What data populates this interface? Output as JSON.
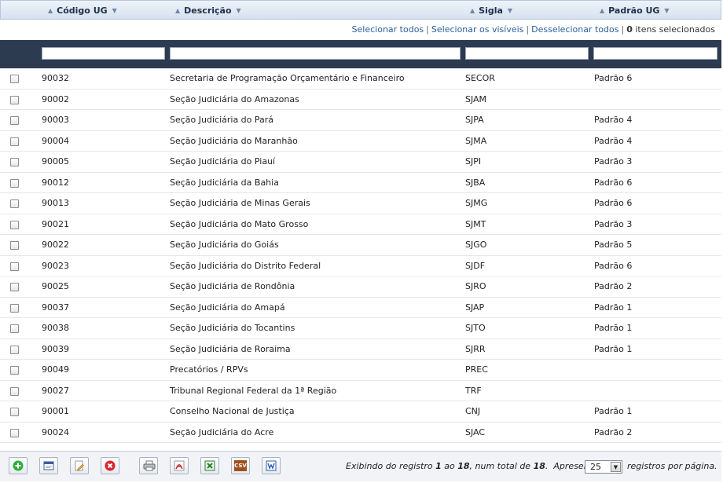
{
  "columns": [
    {
      "label": "Código UG"
    },
    {
      "label": "Descrição"
    },
    {
      "label": "Sigla"
    },
    {
      "label": "Padrão UG"
    }
  ],
  "selection": {
    "select_all": "Selecionar todos",
    "select_visible": "Selecionar os visíveis",
    "deselect_all": "Desselecionar todos",
    "separator": "|",
    "count": "0",
    "count_suffix": "itens selecionados"
  },
  "rows": [
    {
      "codigo": "90032",
      "descricao": "Secretaria de Programação Orçamentário e Financeiro",
      "sigla": "SECOR",
      "padrao": "Padrão 6"
    },
    {
      "codigo": "90002",
      "descricao": "Seção Judiciária do Amazonas",
      "sigla": "SJAM",
      "padrao": ""
    },
    {
      "codigo": "90003",
      "descricao": "Seção Judiciária do Pará",
      "sigla": "SJPA",
      "padrao": "Padrão 4"
    },
    {
      "codigo": "90004",
      "descricao": "Seção Judiciária do Maranhão",
      "sigla": "SJMA",
      "padrao": "Padrão 4"
    },
    {
      "codigo": "90005",
      "descricao": "Seção Judiciária do Piauí",
      "sigla": "SJPI",
      "padrao": "Padrão 3"
    },
    {
      "codigo": "90012",
      "descricao": "Seção Judiciária da Bahia",
      "sigla": "SJBA",
      "padrao": "Padrão 6"
    },
    {
      "codigo": "90013",
      "descricao": "Seção Judiciária de Minas Gerais",
      "sigla": "SJMG",
      "padrao": "Padrão 6"
    },
    {
      "codigo": "90021",
      "descricao": "Seção Judiciária do Mato Grosso",
      "sigla": "SJMT",
      "padrao": "Padrão 3"
    },
    {
      "codigo": "90022",
      "descricao": "Seção Judiciária do Goiás",
      "sigla": "SJGO",
      "padrao": "Padrão 5"
    },
    {
      "codigo": "90023",
      "descricao": "Seção Judiciária do Distrito Federal",
      "sigla": "SJDF",
      "padrao": "Padrão 6"
    },
    {
      "codigo": "90025",
      "descricao": "Seção Judiciária de Rondônia",
      "sigla": "SJRO",
      "padrao": "Padrão 2"
    },
    {
      "codigo": "90037",
      "descricao": "Seção Judiciária do Amapá",
      "sigla": "SJAP",
      "padrao": "Padrão 1"
    },
    {
      "codigo": "90038",
      "descricao": "Seção Judiciária do Tocantins",
      "sigla": "SJTO",
      "padrao": "Padrão 1"
    },
    {
      "codigo": "90039",
      "descricao": "Seção Judiciária de Roraima",
      "sigla": "SJRR",
      "padrao": "Padrão 1"
    },
    {
      "codigo": "90049",
      "descricao": "Precatórios / RPVs",
      "sigla": "PREC",
      "padrao": ""
    },
    {
      "codigo": "90027",
      "descricao": "Tribunal Regional Federal da 1ª Região",
      "sigla": "TRF",
      "padrao": ""
    },
    {
      "codigo": "90001",
      "descricao": "Conselho Nacional de Justiça",
      "sigla": "CNJ",
      "padrao": "Padrão 1"
    },
    {
      "codigo": "90024",
      "descricao": "Seção Judiciária do Acre",
      "sigla": "SJAC",
      "padrao": "Padrão 2"
    }
  ],
  "toolbar": [
    {
      "name": "add-button",
      "icon": "plus-circle-icon"
    },
    {
      "name": "view-button",
      "icon": "window-icon"
    },
    {
      "name": "edit-button",
      "icon": "pencil-icon"
    },
    {
      "name": "delete-button",
      "icon": "x-circle-icon"
    },
    {
      "name": "print-button",
      "icon": "printer-icon"
    },
    {
      "name": "export-pdf-button",
      "icon": "pdf-icon"
    },
    {
      "name": "export-excel-button",
      "icon": "excel-icon"
    },
    {
      "name": "export-csv-button",
      "icon": "csv-icon",
      "text": "CSV"
    },
    {
      "name": "export-word-button",
      "icon": "word-icon"
    }
  ],
  "pagination": {
    "prefix": "Exibindo do registro",
    "from": "1",
    "mid": "ao",
    "to": "18",
    "total_prefix": ", num total de",
    "total": "18",
    "total_suffix": ".",
    "show": "Apresentar",
    "page_size": "25",
    "per_page": "registros por página."
  },
  "colors": {
    "header_bg": "#d6e1ef",
    "filter_bar": "#2d3b50",
    "link": "#2b5f99",
    "add_green": "#2fae3a",
    "delete_red": "#d9262d",
    "pdf_red": "#c8282b",
    "excel_green": "#2e7d32",
    "csv_brown": "#a0501c",
    "word_blue": "#2a5db0"
  }
}
